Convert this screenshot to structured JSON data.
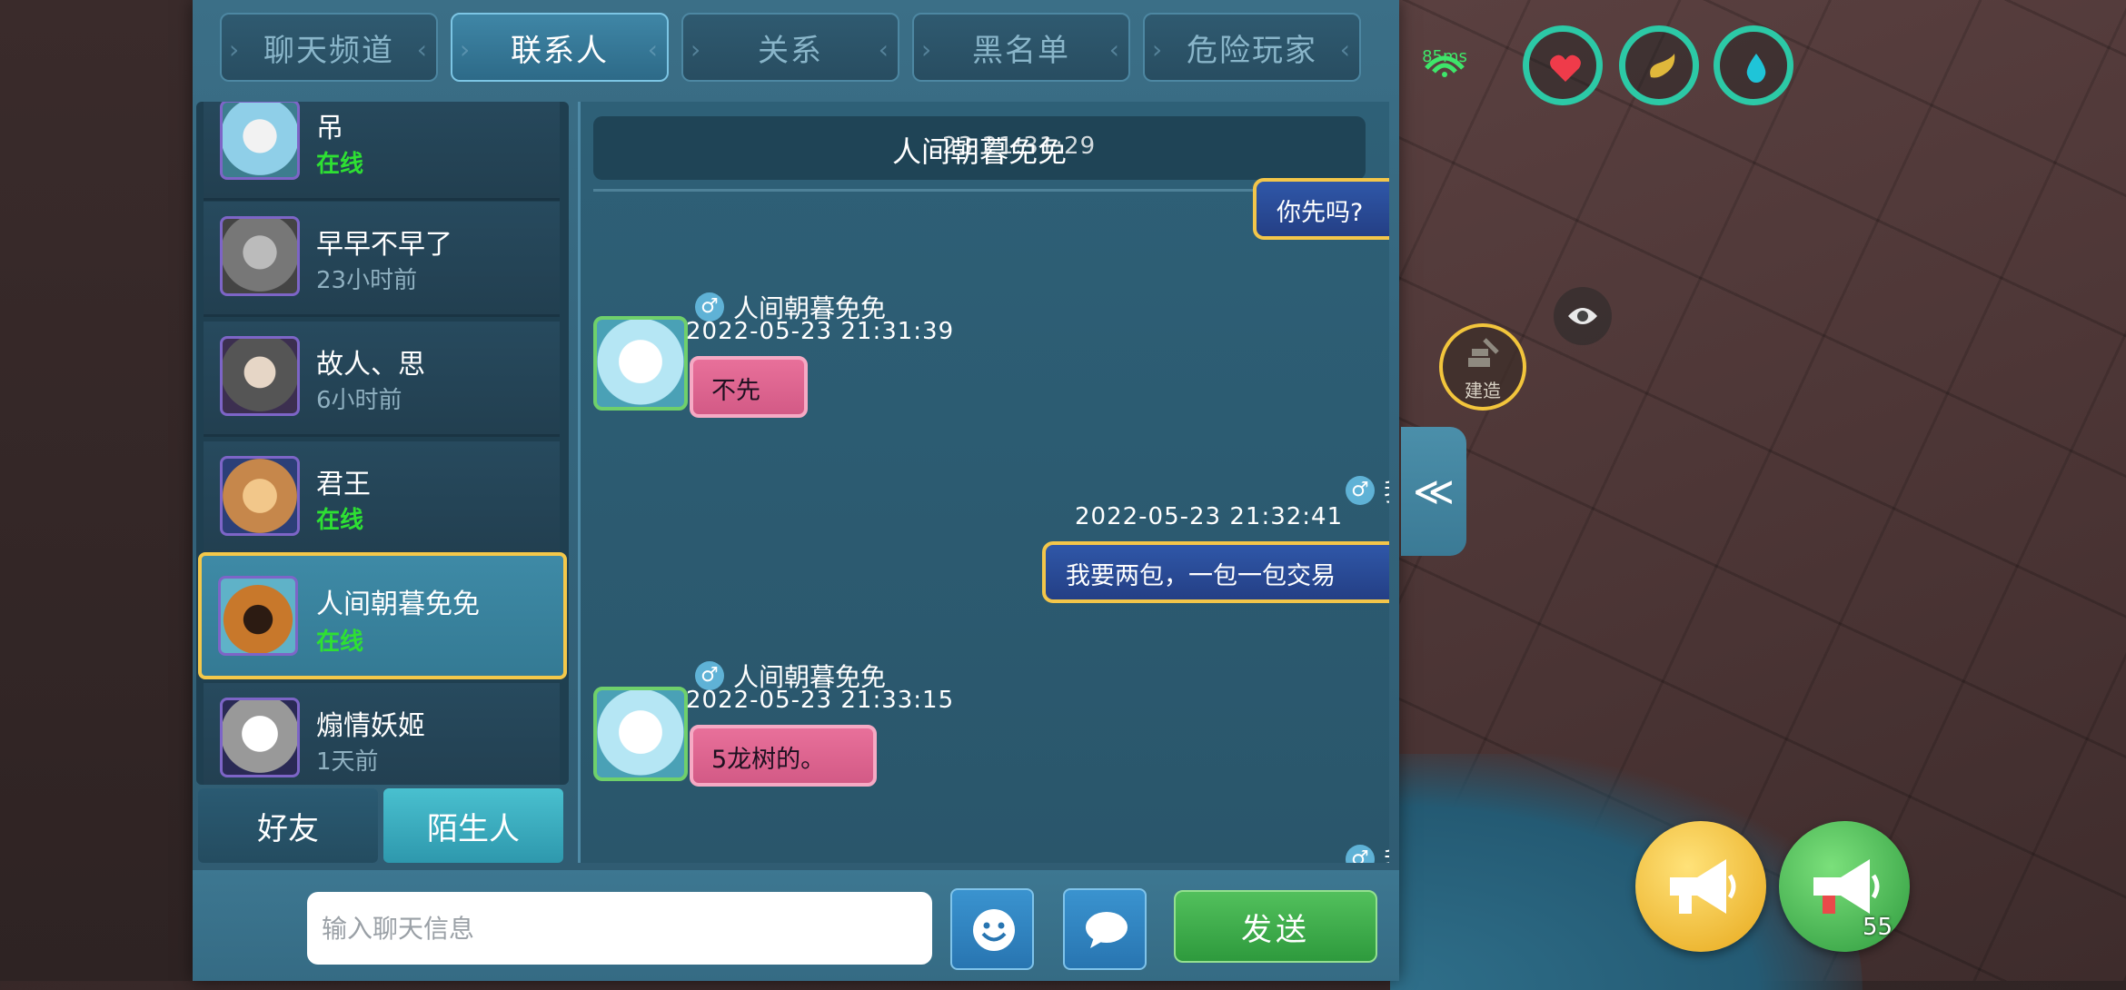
{
  "tabs": [
    "聊天频道",
    "联系人",
    "关系",
    "黑名单",
    "危险玩家"
  ],
  "active_tab": "联系人",
  "contacts": [
    {
      "name": "吊",
      "status": "在线",
      "online": true
    },
    {
      "name": "早早不早了",
      "status": "23小时前",
      "online": false
    },
    {
      "name": "故人、思",
      "status": "6小时前",
      "online": false
    },
    {
      "name": "君王",
      "status": "在线",
      "online": true
    },
    {
      "name": "人间朝暮免免",
      "status": "在线",
      "online": true
    },
    {
      "name": "煽情妖姬",
      "status": "1天前",
      "online": false
    }
  ],
  "subtabs": [
    "好友",
    "陌生人"
  ],
  "chat": {
    "partner": "人间朝暮免免",
    "header_time": "23  21:31:29",
    "messages": [
      {
        "from": "我",
        "text": "你先吗?"
      },
      {
        "from": "人间朝暮免免",
        "time": "2022-05-23  21:31:39",
        "text": "不先"
      },
      {
        "from": "我",
        "time": "2022-05-23  21:32:41",
        "text": "我要两包，一包一包交易"
      },
      {
        "from": "人间朝暮免免",
        "time": "2022-05-23  21:33:15",
        "text": "5龙树的。"
      },
      {
        "from": "我"
      }
    ]
  },
  "input": {
    "placeholder": "输入聊天信息"
  },
  "send_label": "发送",
  "hud": {
    "ping": "85ms",
    "build_label": "建造",
    "horn_count": "55",
    "collapse_glyph": "≪"
  },
  "colors": {
    "online": "#2ee033",
    "selected_border": "#f4c84a",
    "panel": "#34657d"
  }
}
